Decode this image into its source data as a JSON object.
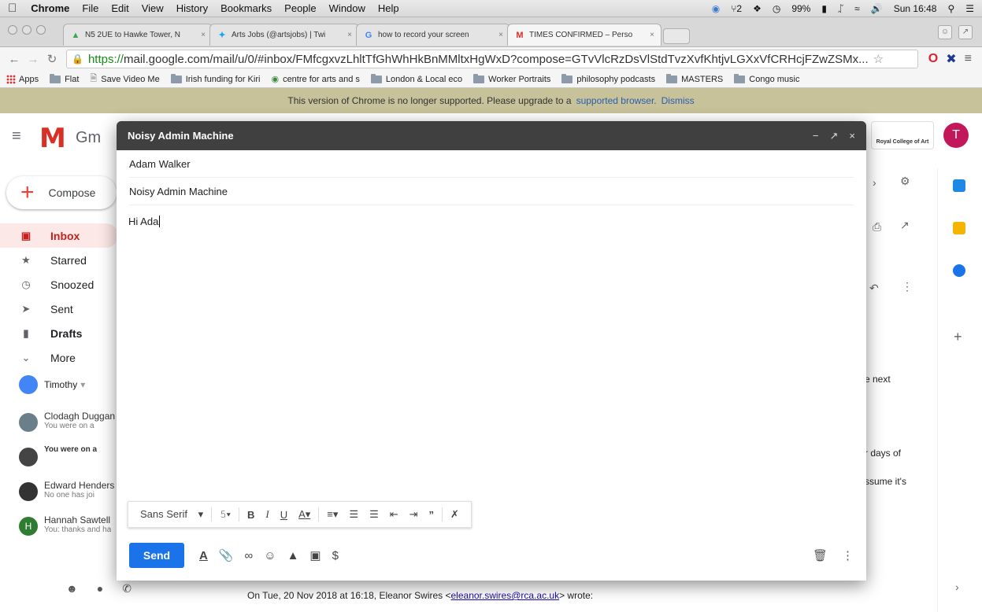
{
  "menubar": {
    "items": [
      "Chrome",
      "File",
      "Edit",
      "View",
      "History",
      "Bookmarks",
      "People",
      "Window",
      "Help"
    ],
    "status_a": "⑂2",
    "battery": "99%",
    "clock": "Sun 16:48"
  },
  "tabs": [
    {
      "label": "N5 2UE to Hawke Tower, N",
      "favicon": "maps-icon"
    },
    {
      "label": "Arts Jobs (@artsjobs) | Twi",
      "favicon": "twitter-icon"
    },
    {
      "label": "how to record your screen",
      "favicon": "google-icon"
    },
    {
      "label": "TIMES CONFIRMED – Perso",
      "favicon": "gmail-icon"
    }
  ],
  "address": {
    "scheme": "https://",
    "rest": "mail.google.com/mail/u/0/#inbox/FMfcgxvzLhltTfGhWhHkBnMMltxHgWxD?compose=GTvVlcRzDsVlStdTvzXvfKhtjvLGXxVfCRHcjFZwZSMx..."
  },
  "bookmarks": [
    "Apps",
    "Flat",
    "Save Video Me",
    "Irish funding for Kiri",
    "centre for arts and s",
    "London & Local eco",
    "Worker Portraits",
    "philosophy podcasts",
    "MASTERS",
    "Congo music"
  ],
  "infobar": {
    "message": "This version of Chrome is no longer supported. Please upgrade to a",
    "link": "supported browser.",
    "dismiss": "Dismiss"
  },
  "gmail": {
    "logo_text": "Gm",
    "compose_label": "Compose",
    "nav": [
      "Inbox",
      "Starred",
      "Snoozed",
      "Sent",
      "Drafts",
      "More"
    ],
    "user": "Timothy",
    "hangouts": [
      {
        "name": "Clodagh Duggan",
        "status": "You were on a"
      },
      {
        "name": "",
        "status": "You were on a"
      },
      {
        "name": "Edward Henders",
        "status": "No one has joi"
      },
      {
        "name": "Hannah Sawtell",
        "status": "You: thanks and ha"
      }
    ],
    "hangout_initial": "H",
    "avatar_initial": "T",
    "rca_label": "Royal College of Art",
    "frag_next": "e next",
    "frag_days": "r days of",
    "frag_assume": "ssume it's",
    "footer": {
      "prefix": "On Tue, 20 Nov 2018 at 16:18, Eleanor Swires <",
      "email": "eleanor.swires@rca.ac.uk",
      "suffix": "> wrote:"
    }
  },
  "compose": {
    "title": "Noisy Admin Machine",
    "to": "Adam Walker",
    "subject": "Noisy Admin Machine",
    "body": "Hi Ada",
    "font": "Sans Serif",
    "send_label": "Send"
  }
}
